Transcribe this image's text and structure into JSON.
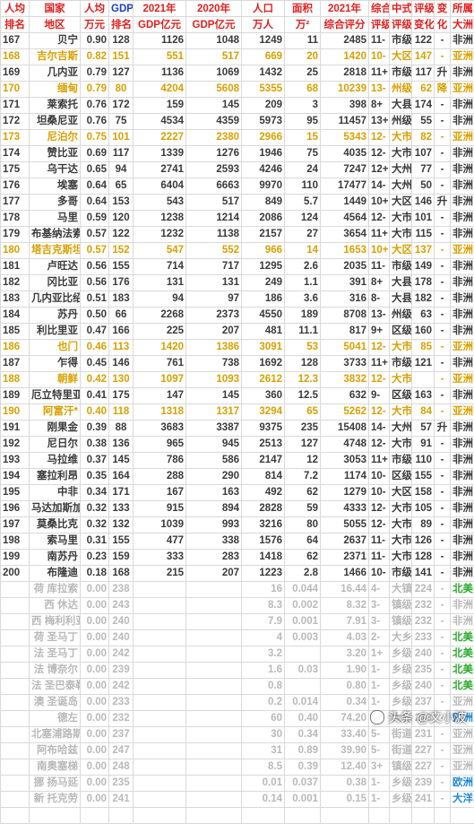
{
  "headers": [
    [
      "人均",
      "排名"
    ],
    [
      "国家",
      "地区"
    ],
    [
      "人均",
      "万元"
    ],
    [
      "GDP",
      "排名"
    ],
    [
      "2021年",
      "GDP亿元"
    ],
    [
      "2020年",
      "GDP亿元"
    ],
    [
      "人口",
      "万人"
    ],
    [
      "面积",
      "万²"
    ],
    [
      "2021年",
      "综合评分"
    ],
    [
      "综合",
      "评级"
    ],
    [
      "中式",
      "评级"
    ],
    [
      "评级",
      "变化"
    ],
    [
      "变",
      "化"
    ],
    [
      "所属",
      "大洲"
    ]
  ],
  "colors": {
    "highlight": "#d9a000",
    "header": "#e02020",
    "dim": "#b9b9b9",
    "green": "#2eaa2e",
    "blue": "#1e88d8"
  },
  "rows": [
    {
      "cells": [
        "167",
        "贝宁",
        "0.90",
        "128",
        "1126",
        "1048",
        "1249",
        "11",
        "2485",
        "11-",
        "市级",
        "122",
        "-",
        "非洲"
      ]
    },
    {
      "hl": true,
      "cells": [
        "168",
        "吉尔吉斯",
        "0.82",
        "151",
        "551",
        "517",
        "669",
        "20",
        "1420",
        "10-",
        "大区",
        "147",
        "-",
        "亚洲"
      ]
    },
    {
      "cells": [
        "169",
        "几内亚",
        "0.79",
        "127",
        "1136",
        "1069",
        "1432",
        "25",
        "2818",
        "11+",
        "市级",
        "117",
        "升",
        "非洲"
      ]
    },
    {
      "hl": true,
      "cells": [
        "170",
        "缅甸",
        "0.79",
        "80",
        "4204",
        "5608",
        "5355",
        "68",
        "10239",
        "13-",
        "州级",
        "62",
        "降",
        "亚洲"
      ]
    },
    {
      "cells": [
        "171",
        "莱索托",
        "0.76",
        "172",
        "159",
        "145",
        "209",
        "3",
        "398",
        "8+",
        "大县",
        "174",
        "-",
        "非洲"
      ]
    },
    {
      "cells": [
        "172",
        "坦桑尼亚",
        "0.76",
        "75",
        "4534",
        "4359",
        "5973",
        "95",
        "11457",
        "13+",
        "州级",
        "55",
        "-",
        "非洲"
      ]
    },
    {
      "hl": true,
      "cells": [
        "173",
        "尼泊尔",
        "0.75",
        "101",
        "2227",
        "2380",
        "2966",
        "15",
        "5343",
        "12-",
        "大市",
        "82",
        "-",
        "亚洲"
      ]
    },
    {
      "cells": [
        "174",
        "赞比亚",
        "0.69",
        "117",
        "1339",
        "1276",
        "1946",
        "75",
        "4035",
        "12-",
        "大市",
        "107",
        "-",
        "非洲"
      ]
    },
    {
      "cells": [
        "175",
        "乌干达",
        "0.65",
        "94",
        "2741",
        "2593",
        "4246",
        "24",
        "7247",
        "12+",
        "大州",
        "77",
        "-",
        "非洲"
      ]
    },
    {
      "cells": [
        "176",
        "埃塞",
        "0.64",
        "65",
        "6404",
        "6663",
        "9970",
        "110",
        "17477",
        "14-",
        "大州",
        "50",
        "-",
        "非洲"
      ]
    },
    {
      "cells": [
        "177",
        "多哥",
        "0.64",
        "153",
        "543",
        "517",
        "849",
        "5.7",
        "1449",
        "10+",
        "大区",
        "146",
        "升",
        "非洲"
      ]
    },
    {
      "cells": [
        "178",
        "马里",
        "0.59",
        "120",
        "1238",
        "1214",
        "2086",
        "124",
        "4564",
        "12-",
        "大市",
        "101",
        "-",
        "非洲"
      ]
    },
    {
      "cells": [
        "179",
        "布基纳法索",
        "0.57",
        "122",
        "1232",
        "1138",
        "2157",
        "27",
        "3654",
        "11+",
        "大市",
        "115",
        "-",
        "非洲"
      ]
    },
    {
      "hl": true,
      "cells": [
        "180",
        "塔吉克斯坦",
        "0.57",
        "152",
        "547",
        "552",
        "966",
        "14",
        "1653",
        "10+",
        "大区",
        "137",
        "-",
        "亚洲"
      ]
    },
    {
      "cells": [
        "181",
        "卢旺达",
        "0.56",
        "155",
        "714",
        "717",
        "1295",
        "2.6",
        "2035",
        "11-",
        "市级",
        "149",
        "-",
        "非洲"
      ]
    },
    {
      "cells": [
        "182",
        "冈比亚",
        "0.56",
        "176",
        "131",
        "131",
        "249",
        "1.1",
        "391",
        "8+",
        "大县",
        "178",
        "-",
        "非洲"
      ]
    },
    {
      "cells": [
        "183",
        "几内亚比绍",
        "0.51",
        "183",
        "94",
        "97",
        "186",
        "3.6",
        "316",
        "8-",
        "大县",
        "182",
        "-",
        "非洲"
      ]
    },
    {
      "cells": [
        "184",
        "苏丹",
        "0.50",
        "66",
        "2268",
        "2373",
        "4550",
        "189",
        "8708",
        "13-",
        "州级",
        "63",
        "-",
        "非洲"
      ]
    },
    {
      "cells": [
        "185",
        "利比里亚",
        "0.47",
        "166",
        "225",
        "207",
        "481",
        "11.1",
        "817",
        "9+",
        "区级",
        "160",
        "-",
        "非洲"
      ]
    },
    {
      "hl": true,
      "cells": [
        "186",
        "也门",
        "0.46",
        "113",
        "1420",
        "1386",
        "3091",
        "53",
        "5041",
        "12-",
        "大市",
        "85",
        "-",
        "亚洲"
      ]
    },
    {
      "cells": [
        "187",
        "乍得",
        "0.45",
        "146",
        "761",
        "738",
        "1692",
        "128",
        "3733",
        "11+",
        "市级",
        "121",
        "-",
        "非洲"
      ]
    },
    {
      "hl": true,
      "cells": [
        "188",
        "朝鲜",
        "0.42",
        "130",
        "1097",
        "1093",
        "2612",
        "12.3",
        "3832",
        "12-",
        "大市",
        "",
        "-",
        "亚洲"
      ]
    },
    {
      "cells": [
        "189",
        "厄立特里亚",
        "0.41",
        "175",
        "147",
        "145",
        "360",
        "12.5",
        "632",
        "9-",
        "区级",
        "163",
        "-",
        "非洲"
      ]
    },
    {
      "hl": true,
      "cells": [
        "190",
        "阿富汗*",
        "0.40",
        "118",
        "1318",
        "1317",
        "3294",
        "65",
        "5262",
        "12-",
        "大市",
        "84",
        "-",
        "亚洲"
      ]
    },
    {
      "cells": [
        "191",
        "刚果金",
        "0.39",
        "88",
        "3683",
        "3387",
        "9375",
        "235",
        "15408",
        "14-",
        "大州",
        "57",
        "升",
        "非洲"
      ]
    },
    {
      "cells": [
        "192",
        "尼日尔",
        "0.38",
        "136",
        "965",
        "945",
        "2513",
        "127",
        "4748",
        "12-",
        "大市",
        "91",
        "-",
        "非洲"
      ]
    },
    {
      "cells": [
        "193",
        "马拉维",
        "0.37",
        "145",
        "786",
        "586",
        "2147",
        "12",
        "3053",
        "11+",
        "市级",
        "110",
        "-",
        "非洲"
      ]
    },
    {
      "cells": [
        "194",
        "塞拉利昂",
        "0.35",
        "164",
        "288",
        "290",
        "814",
        "7.2",
        "1174",
        "10-",
        "区级",
        "155",
        "-",
        "非洲"
      ]
    },
    {
      "cells": [
        "195",
        "中非",
        "0.34",
        "171",
        "167",
        "163",
        "492",
        "62",
        "1279",
        "10-",
        "大区",
        "158",
        "-",
        "非洲"
      ]
    },
    {
      "cells": [
        "196",
        "马达加斯加",
        "0.32",
        "133",
        "915",
        "894",
        "2828",
        "59",
        "4333",
        "12-",
        "大市",
        "105",
        "-",
        "非洲"
      ]
    },
    {
      "cells": [
        "197",
        "莫桑比克",
        "0.32",
        "132",
        "1039",
        "993",
        "3216",
        "80",
        "5055",
        "12-",
        "大市",
        "89",
        "-",
        "非洲"
      ]
    },
    {
      "cells": [
        "198",
        "索马里",
        "0.31",
        "155",
        "477",
        "338",
        "1576",
        "64",
        "2637",
        "11-",
        "大市",
        "126",
        "-",
        "非洲"
      ]
    },
    {
      "cells": [
        "199",
        "南苏丹",
        "0.23",
        "159",
        "333",
        "283",
        "1418",
        "62",
        "2371",
        "11-",
        "大市",
        "128",
        "-",
        "非洲"
      ]
    },
    {
      "cells": [
        "200",
        "布隆迪",
        "0.18",
        "168",
        "215",
        "207",
        "1223",
        "2.8",
        "1466",
        "10-",
        "市级",
        "141",
        "-",
        "非洲"
      ]
    },
    {
      "dim": true,
      "cont": "green",
      "cells": [
        "",
        "荷 库拉索",
        "0.00",
        "238",
        "",
        "",
        "16",
        "0.044",
        "16.44",
        "4-",
        "大镇",
        "224",
        "-",
        "北美"
      ]
    },
    {
      "dim": true,
      "cont": "",
      "cells": [
        "",
        "西 休达",
        "0.00",
        "243",
        "",
        "",
        "8.3",
        "0.002",
        "8.32",
        "3-",
        "镇级",
        "232",
        "-",
        "非洲"
      ]
    },
    {
      "dim": true,
      "cont": "",
      "cells": [
        "",
        "西 梅利利亚",
        "0.00",
        "240",
        "",
        "",
        "7.9",
        "0.001",
        "7.91",
        "3-",
        "镇级",
        "232",
        "-",
        "非洲"
      ]
    },
    {
      "dim": true,
      "cont": "green",
      "cells": [
        "",
        "荷 圣马丁",
        "0.00",
        "240",
        "",
        "",
        "4",
        "0.003",
        "4.03",
        "2-",
        "大乡",
        "233",
        "-",
        "北美"
      ]
    },
    {
      "dim": true,
      "cont": "green",
      "cells": [
        "",
        "法 圣马丁",
        "0.00",
        "242",
        "",
        "",
        "3.2",
        "",
        "3.20",
        "1+",
        "乡级",
        "240",
        "-",
        "北美"
      ]
    },
    {
      "dim": true,
      "cont": "green",
      "cells": [
        "",
        "法 博奈尔",
        "0.00",
        "239",
        "",
        "",
        "1.6",
        "0.03",
        "1.90",
        "1-",
        "乡级",
        "235",
        "-",
        "北美"
      ]
    },
    {
      "dim": true,
      "cont": "green",
      "cells": [
        "",
        "法 圣巴泰勒",
        "0.00",
        "242",
        "",
        "",
        "0.8",
        "",
        "0.80",
        "1-",
        "乡级",
        "240",
        "-",
        "北美"
      ]
    },
    {
      "dim": true,
      "cont": "",
      "cells": [
        "",
        "澳 圣诞岛",
        "0.00",
        "233",
        "",
        "",
        "0.2",
        "0.014",
        "0.34",
        "1-",
        "乡级",
        "237",
        "-",
        "亚洲"
      ]
    },
    {
      "dim": true,
      "cont": "blue",
      "cells": [
        "",
        "德左",
        "0.00",
        "232",
        "",
        "",
        "60",
        "0.40",
        "74.20",
        "5+",
        "大街",
        "213",
        "-",
        "欧洲"
      ]
    },
    {
      "dim": true,
      "cont": "",
      "cells": [
        "",
        "北塞浦路斯",
        "0.00",
        "237",
        "",
        "",
        "30",
        "0.34",
        "33.40",
        "5-",
        "街道",
        "231",
        "-",
        "亚洲"
      ]
    },
    {
      "dim": true,
      "cont": "",
      "cells": [
        "",
        "阿布哈兹",
        "0.00",
        "247",
        "",
        "",
        "31",
        "0.89",
        "39.90",
        "5-",
        "街道",
        "227",
        "-",
        "亚洲"
      ]
    },
    {
      "dim": true,
      "cont": "",
      "cells": [
        "",
        "南奥塞梯",
        "0.00",
        "248",
        "",
        "",
        "8.5",
        "0.39",
        "12.40",
        "3+",
        "镇级",
        "227",
        "-",
        "亚洲"
      ]
    },
    {
      "dim": true,
      "cont": "blue",
      "cells": [
        "",
        "挪 扬马延",
        "0.00",
        "235",
        "",
        "",
        "0.01",
        "0.037",
        "0.38",
        "1-",
        "乡级",
        "239",
        "-",
        "欧洲"
      ]
    },
    {
      "dim": true,
      "cont": "blue",
      "cells": [
        "",
        "新 托克劳",
        "0.00",
        "241",
        "",
        "",
        "0.14",
        "0.001",
        "0.15",
        "1-",
        "乡级",
        "241",
        "-",
        "大洋"
      ]
    },
    {
      "dim": true,
      "cont": "",
      "cells": [
        "",
        "",
        "",
        "",
        "",
        "",
        "",
        "",
        "",
        "",
        "",
        "",
        "",
        ""
      ]
    }
  ],
  "watermark": "头条 @文小波"
}
